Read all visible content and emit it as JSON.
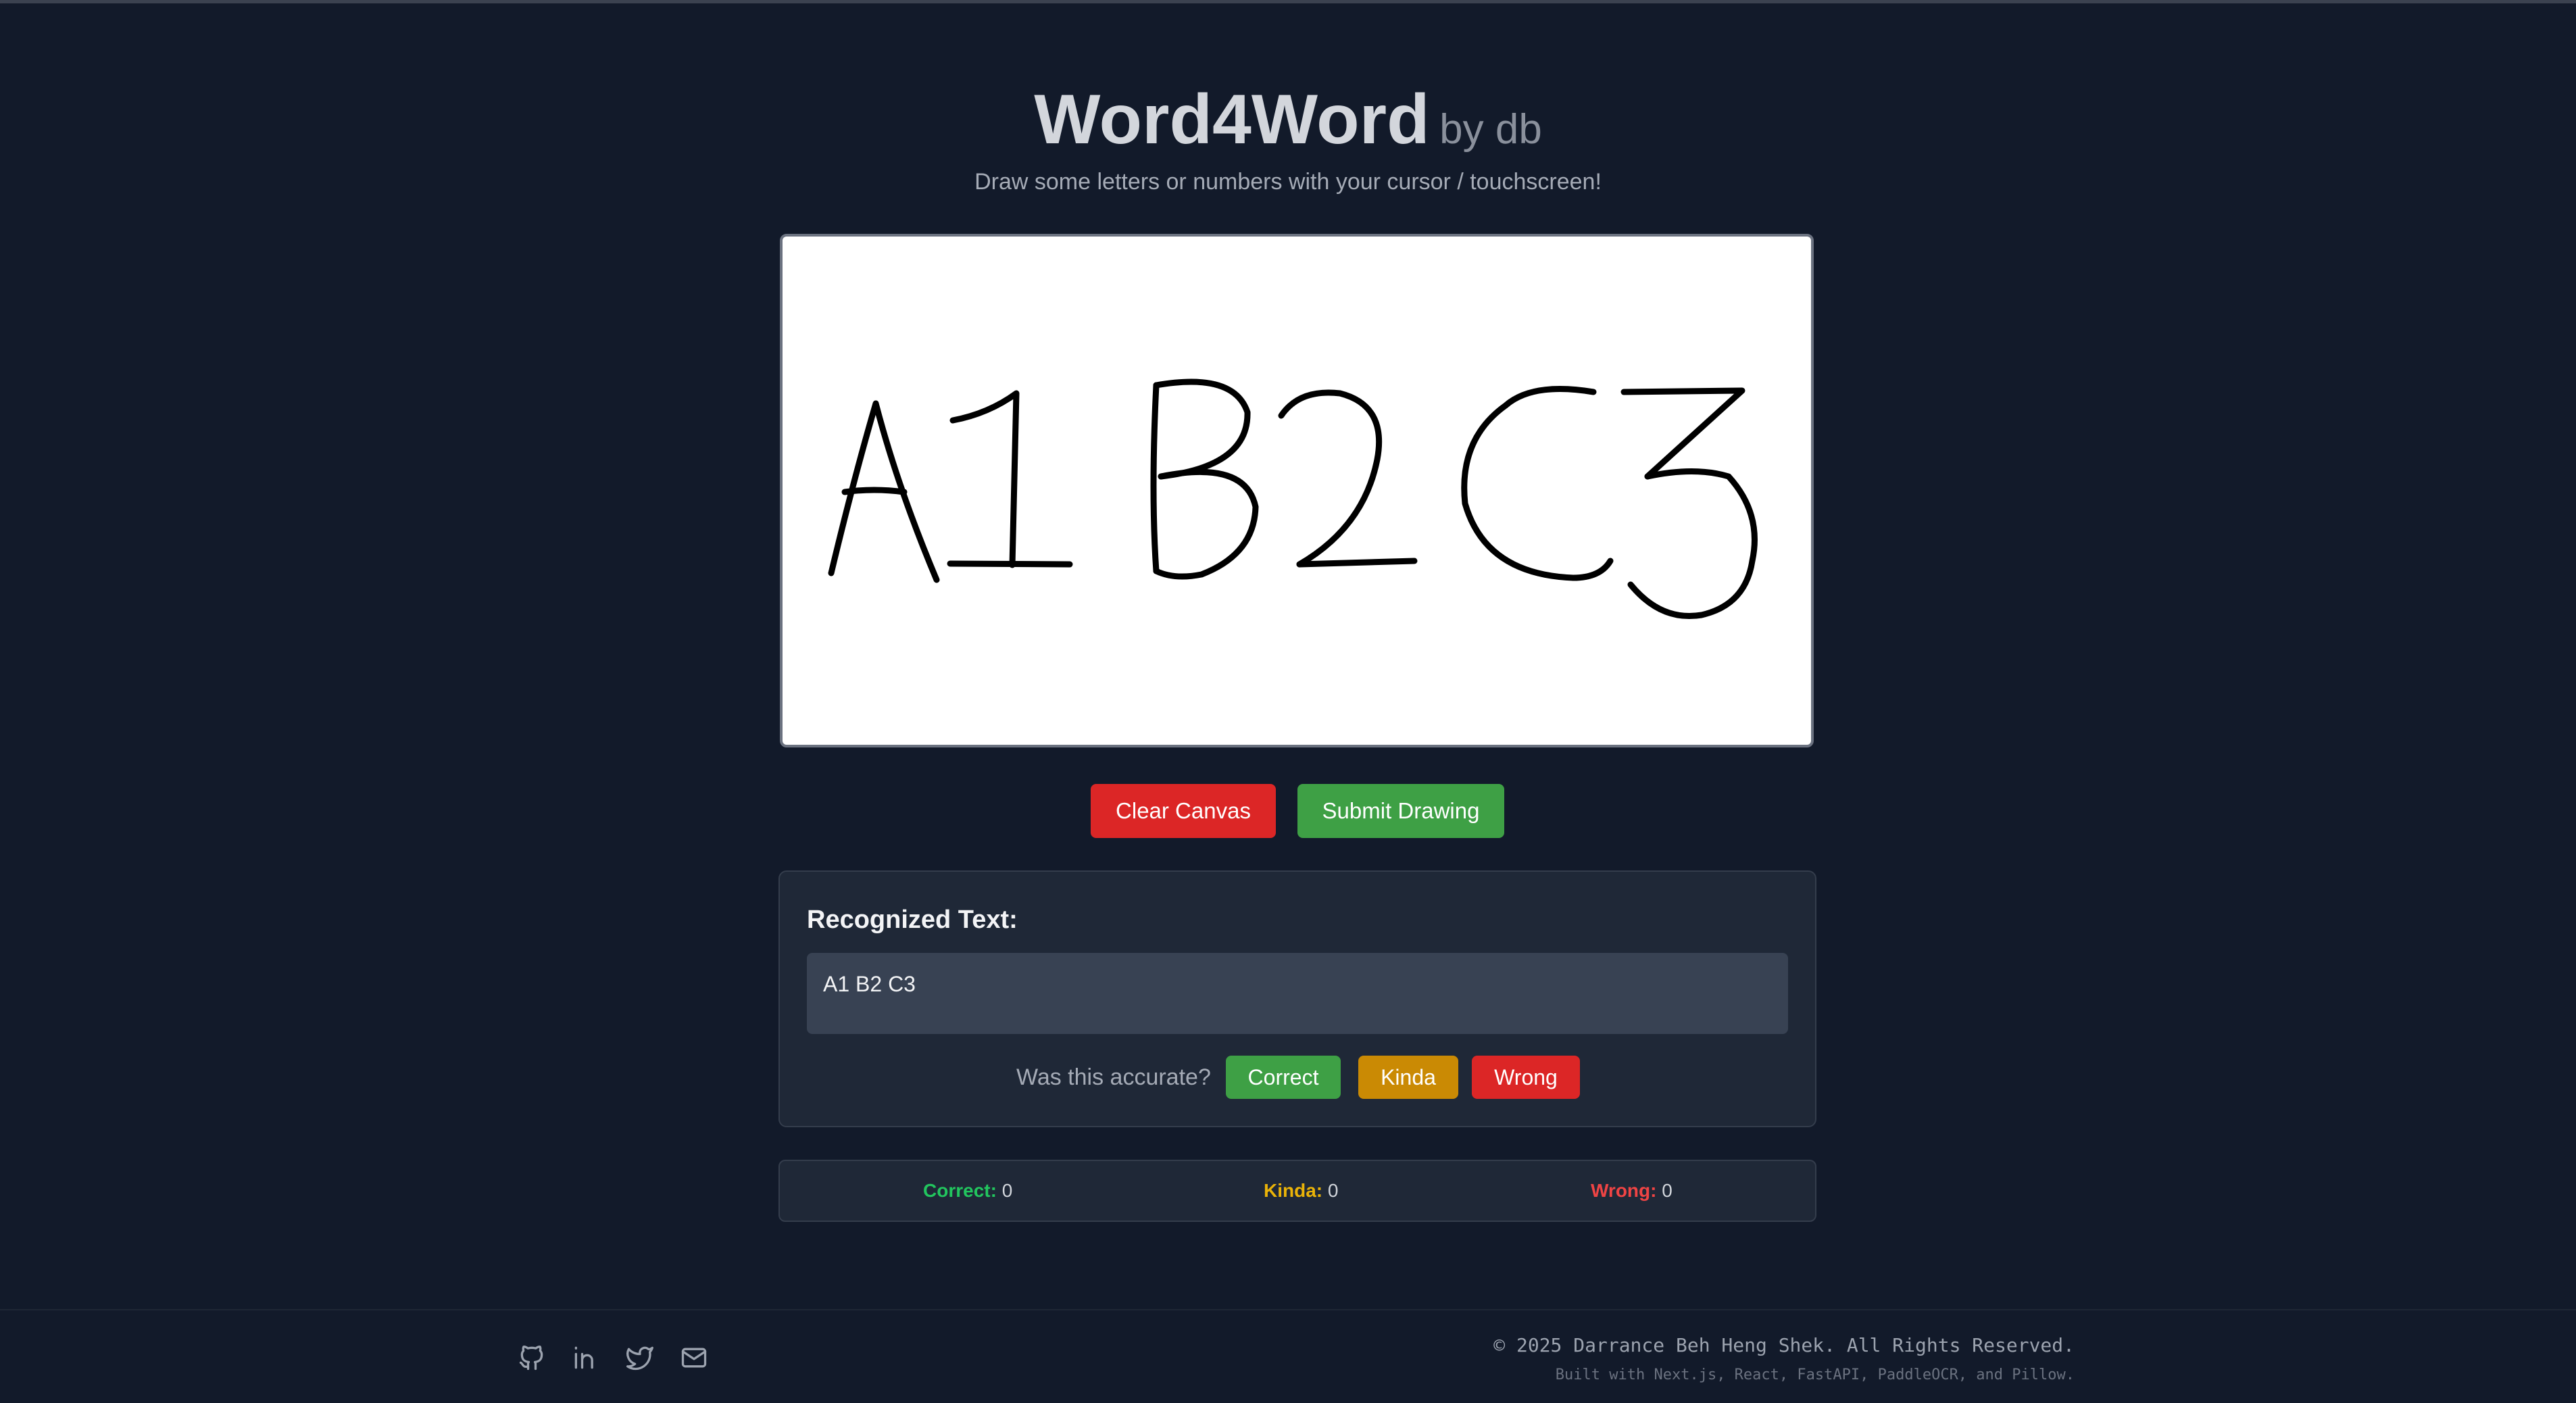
{
  "header": {
    "title": "Word4Word",
    "byline": "by db",
    "subtitle": "Draw some letters or numbers with your cursor / touchscreen!"
  },
  "canvas": {
    "drawing_content": "A1 B2 C3",
    "stroke_color": "#000000",
    "background": "#ffffff"
  },
  "actions": {
    "clear_label": "Clear Canvas",
    "submit_label": "Submit Drawing"
  },
  "result": {
    "heading": "Recognized Text:",
    "text": "A1 B2 C3",
    "accuracy_prompt": "Was this accurate?",
    "correct_label": "Correct",
    "kinda_label": "Kinda",
    "wrong_label": "Wrong"
  },
  "stats": {
    "correct_label": "Correct:",
    "correct_value": "0",
    "kinda_label": "Kinda:",
    "kinda_value": "0",
    "wrong_label": "Wrong:",
    "wrong_value": "0"
  },
  "footer": {
    "icons": [
      "github-icon",
      "linkedin-icon",
      "twitter-icon",
      "mail-icon"
    ],
    "copyright": "© 2025 Darrance Beh Heng Shek. All Rights Reserved.",
    "built_with": "Built with Next.js, React, FastAPI, PaddleOCR, and Pillow."
  },
  "colors": {
    "background": "#121a2a",
    "clear": "#dc2626",
    "submit": "#3ea045",
    "kinda": "#ca8a04",
    "correct_stat": "#22c55e",
    "kinda_stat": "#eab308",
    "wrong_stat": "#ef4444"
  }
}
